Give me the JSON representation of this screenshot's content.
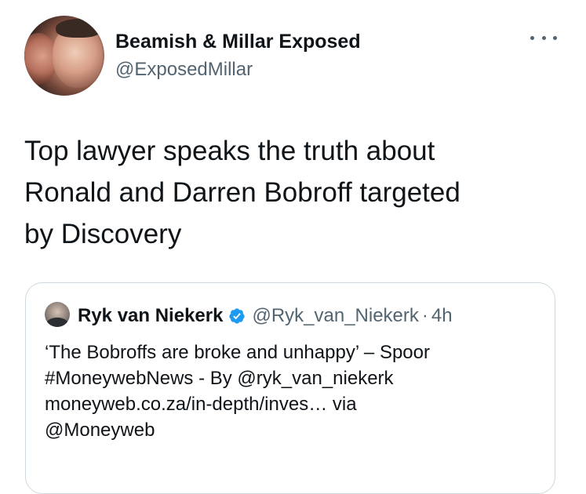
{
  "tweet": {
    "author_name": "Beamish & Millar Exposed",
    "author_handle": "@ExposedMillar",
    "text_lines": [
      "Top lawyer speaks the truth about",
      "Ronald and Darren Bobroff targeted",
      "by Discovery"
    ],
    "more_icon": "more-horizontal-icon"
  },
  "quoted_tweet": {
    "author_name": "Ryk van Niekerk",
    "verified_icon": "verified-badge-icon",
    "author_handle": "@Ryk_van_Niekerk",
    "separator": "·",
    "time": "4h",
    "text_lines": [
      "‘The Bobroffs are broke and unhappy’ – Spoor",
      "#MoneywebNews - By @ryk_van_niekerk",
      "moneyweb.co.za/in-depth/inves… via",
      "@Moneyweb"
    ]
  },
  "colors": {
    "primary_text": "#0f1419",
    "secondary_text": "#536471",
    "border": "#cfd9de",
    "verified_blue": "#1d9bf0"
  }
}
